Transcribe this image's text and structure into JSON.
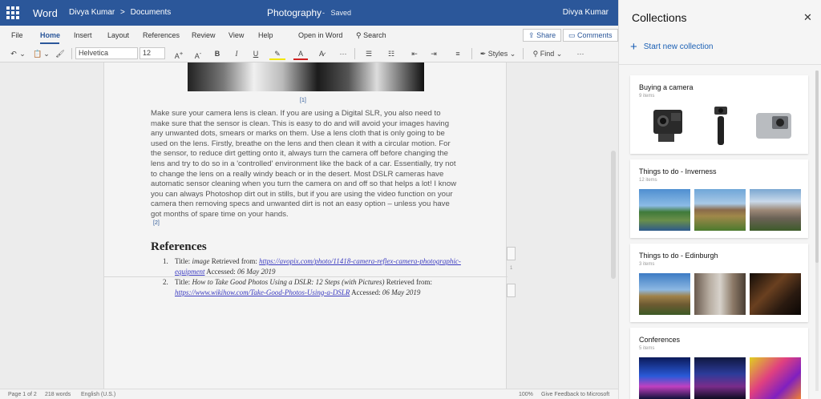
{
  "titlebar": {
    "app_name": "Word",
    "breadcrumb": [
      "Divya Kumar",
      ">",
      "Documents"
    ],
    "doc_name": "Photography",
    "separator": "-",
    "save_status": "Saved",
    "user": "Divya Kumar"
  },
  "menu": {
    "tabs": [
      "File",
      "Home",
      "Insert",
      "Layout",
      "References",
      "Review",
      "View",
      "Help"
    ],
    "open_in_word": "Open in Word",
    "search": "Search",
    "share": "Share",
    "comments": "Comments"
  },
  "toolbar": {
    "font": "Helvetica",
    "size": "12",
    "styles": "Styles",
    "find": "Find",
    "more": "···"
  },
  "document": {
    "ref1": "[1]",
    "paragraph": "Make sure your camera lens is clean. If you are using a Digital SLR, you also need to make sure that the sensor is clean. This is easy to do and will avoid your images having any unwanted dots, smears or marks on them. Use a lens cloth that is only going to be used on the lens. Firstly, breathe on the lens and then clean it with a circular motion. For the sensor, to reduce dirt getting onto it, always turn the camera off before changing the lens and try to do so in a 'controlled' environment like the back of a car. Essentially, try not to change the lens on a really windy beach or in the desert. Most DSLR cameras have automatic sensor cleaning when you turn the camera on and off so that helps a lot! I know you can always Photoshop dirt out in stills, but if you are using the video function on your camera then removing specs and unwanted dirt is not an easy option – unless you have got months of spare time on your hands.",
    "ref2": "[2]",
    "references_heading": "References",
    "references": [
      {
        "num": "1.",
        "title_prefix": "Title:",
        "title": "image",
        "retrieved": "Retrieved from:",
        "url": "https://avopix.com/photo/11418-camera-reflex-camera-photographic-equipment",
        "accessed": "Accessed:",
        "date": "06 May 2019"
      },
      {
        "num": "2.",
        "title_prefix": "Title:",
        "title": "How to Take Good Photos Using a DSLR: 12 Steps (with Pictures)",
        "retrieved": "Retrieved from:",
        "url": "https://www.wikihow.com/Take-Good-Photos-Using-a-DSLR",
        "accessed": "Accessed:",
        "date": "06 May 2019"
      }
    ],
    "page_marker": "1"
  },
  "statusbar": {
    "page": "Page 1 of 2",
    "words": "218 words",
    "language": "English (U.S.)",
    "zoom": "100%",
    "feedback": "Give Feedback to Microsoft"
  },
  "collections": {
    "title": "Collections",
    "close": "✕",
    "new_collection": "Start new collection",
    "plus": "+",
    "cards": [
      {
        "title": "Buying a camera",
        "count": "9 items",
        "images": [
          "action-camera",
          "gimbal",
          "white-camera"
        ]
      },
      {
        "title": "Things to do - Inverness",
        "count": "12 items",
        "images": [
          "river-castle",
          "castle-hill",
          "riverside-houses"
        ]
      },
      {
        "title": "Things to do - Edinburgh",
        "count": "3 items",
        "images": [
          "edinburgh-castle",
          "royal-mile-street",
          "night-street"
        ]
      },
      {
        "title": "Conferences",
        "count": "5 items",
        "images": [
          "stage-blue",
          "audience-night",
          "colorful-stage"
        ]
      }
    ]
  },
  "colors": {
    "word_blue": "#2b579a",
    "link_blue": "#1a5fb4"
  }
}
